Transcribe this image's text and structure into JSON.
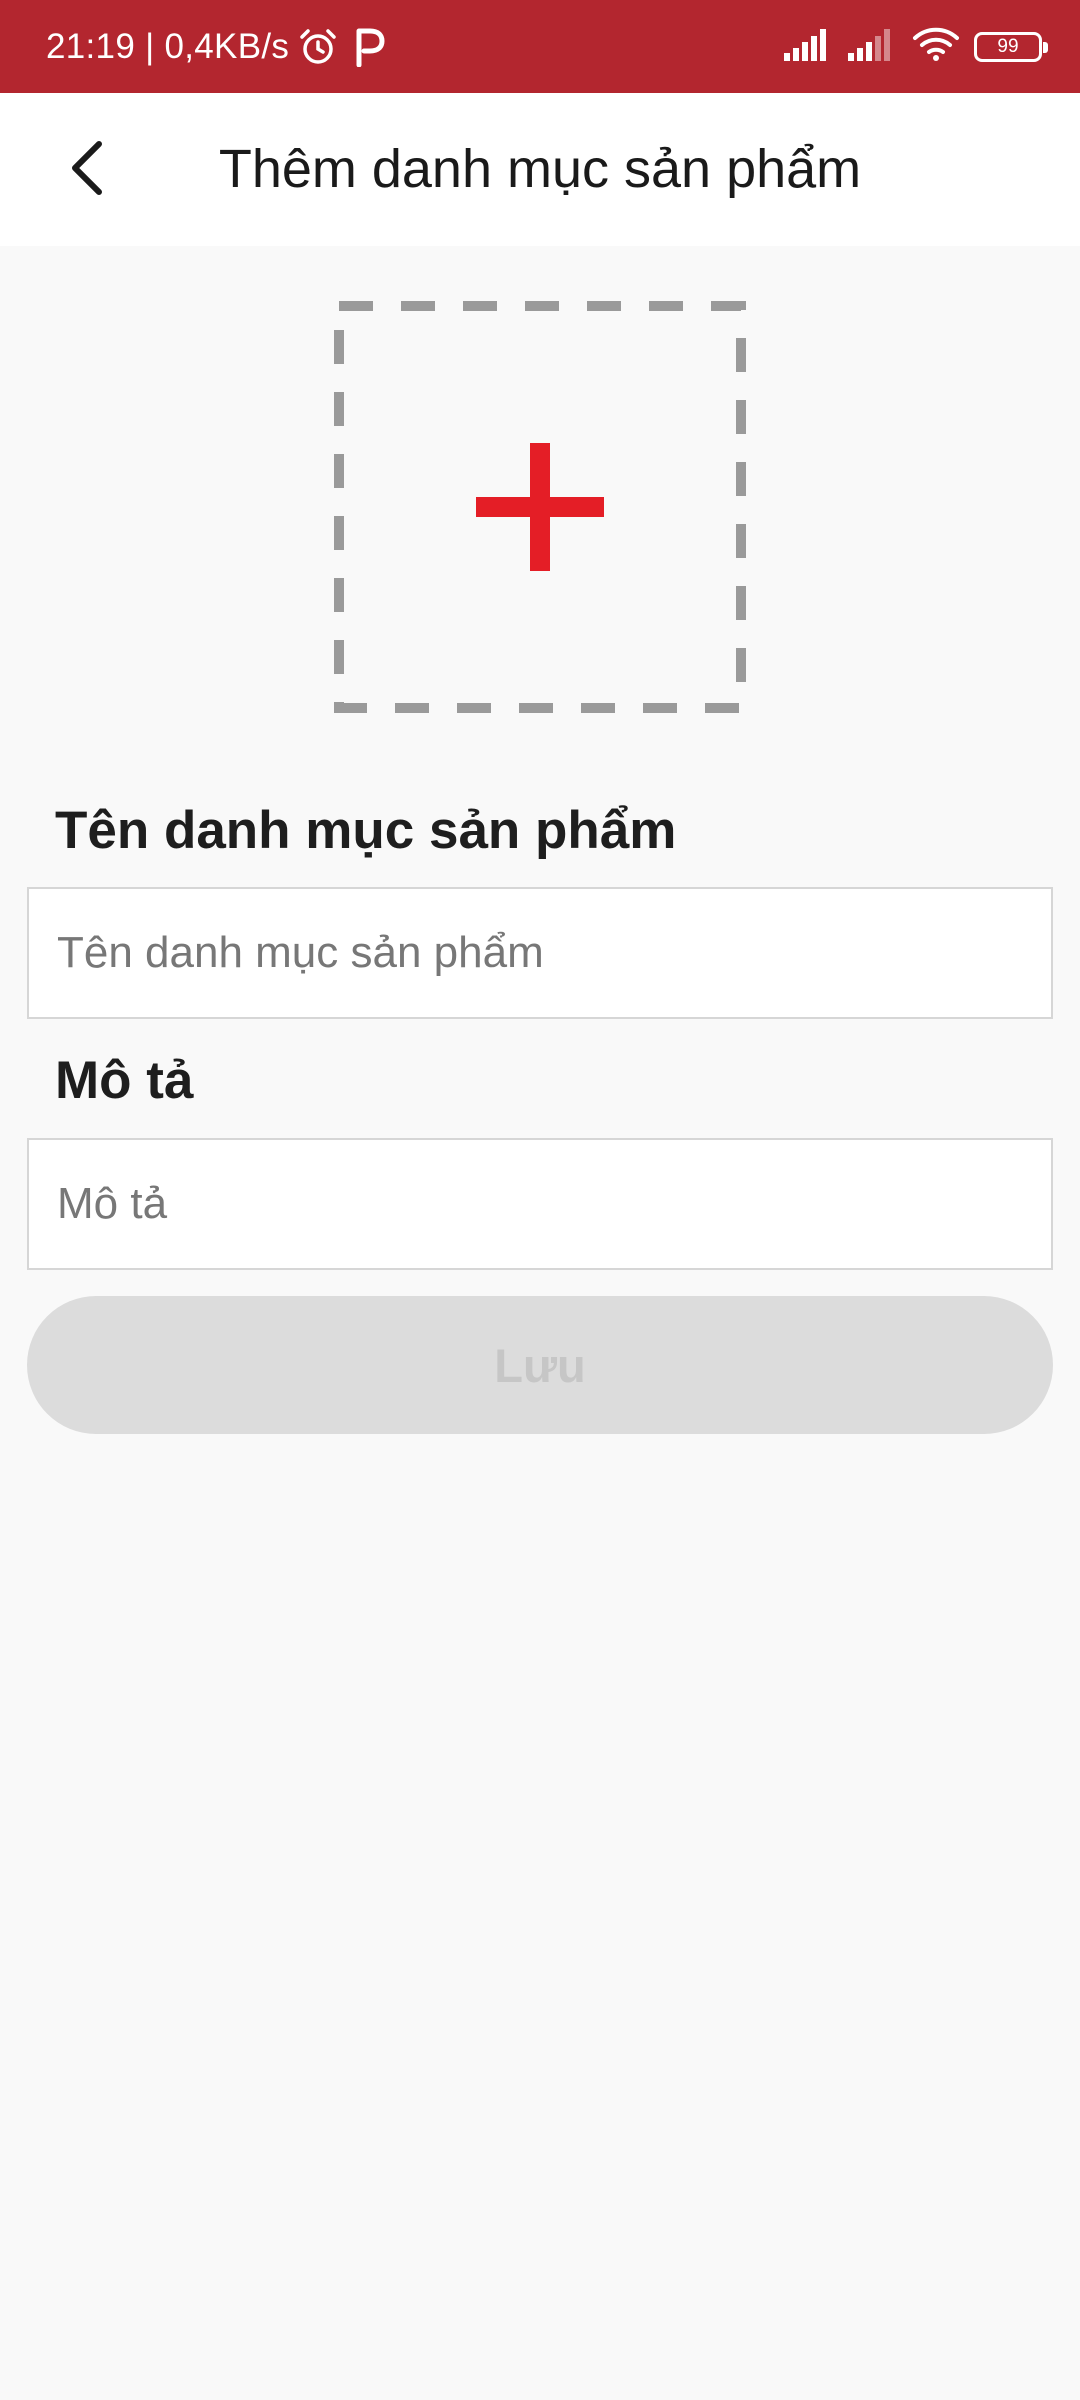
{
  "status_bar": {
    "time": "21:19",
    "separator": "|",
    "network_speed": "0,4KB/s",
    "battery_level": "99",
    "icons": [
      "alarm-icon",
      "parking-icon",
      "signal-icon",
      "signal-icon",
      "wifi-icon",
      "battery-icon"
    ]
  },
  "header": {
    "back_icon": "chevron-left-icon",
    "title": "Thêm danh mục sản phẩm"
  },
  "image_upload": {
    "icon": "plus-icon",
    "accent_color": "#e41e26",
    "border_color": "#9a9a9a"
  },
  "form": {
    "name": {
      "label": "Tên danh mục sản phẩm",
      "placeholder": "Tên danh mục sản phẩm",
      "value": ""
    },
    "description": {
      "label": "Mô tả",
      "placeholder": "Mô tả",
      "value": ""
    },
    "save_label": "Lưu"
  },
  "colors": {
    "status_bar": "#b3262f",
    "background": "#f9f9f9",
    "button_disabled_bg": "#dcdcdc",
    "button_disabled_text": "#c6c6c6"
  }
}
